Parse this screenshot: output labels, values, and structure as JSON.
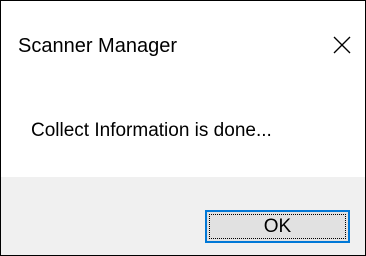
{
  "window": {
    "title": "Scanner Manager",
    "close_icon": "close-icon"
  },
  "message": {
    "text": "Collect Information is done..."
  },
  "buttons": {
    "ok_label": "OK"
  },
  "colors": {
    "accent": "#0078d7",
    "footer_background": "#f0f0f0",
    "button_face": "#e1e1e1"
  }
}
